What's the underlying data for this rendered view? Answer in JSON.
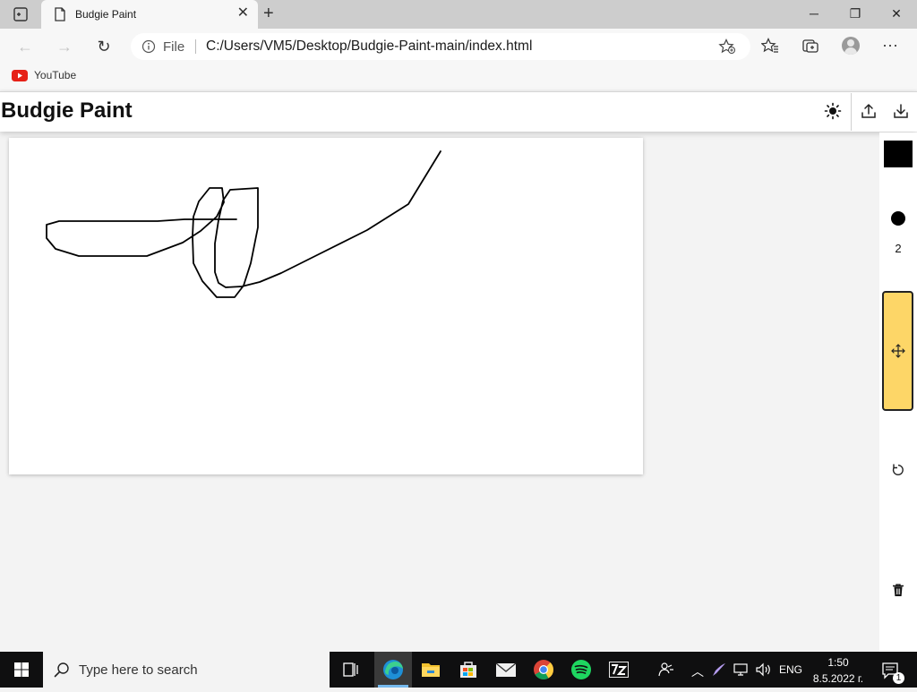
{
  "browser": {
    "tab_title": "Budgie Paint",
    "address_scheme": "File",
    "address_url": "C:/Users/VM5/Desktop/Budgie-Paint-main/index.html",
    "bookmarks": [
      {
        "label": "YouTube",
        "icon": "youtube-icon"
      }
    ]
  },
  "app": {
    "title": "Budgie Paint",
    "header_icons": [
      "theme-sun-icon",
      "upload-icon",
      "download-icon"
    ],
    "sidebar": {
      "color": "#000000",
      "brush_size": "2",
      "move_tool_color": "#fdd667",
      "icons": [
        "color-swatch",
        "brush-dot-icon",
        "move-icon",
        "reset-icon",
        "trash-icon"
      ]
    }
  },
  "taskbar": {
    "search_placeholder": "Type here to search",
    "language": "ENG",
    "time": "1:50",
    "date": "8.5.2022 г.",
    "notification_count": "1",
    "pinned": [
      "task-view-icon",
      "edge-icon",
      "file-explorer-icon",
      "store-icon",
      "mail-icon",
      "chrome-icon",
      "spotify-icon",
      "7zip-icon"
    ]
  }
}
